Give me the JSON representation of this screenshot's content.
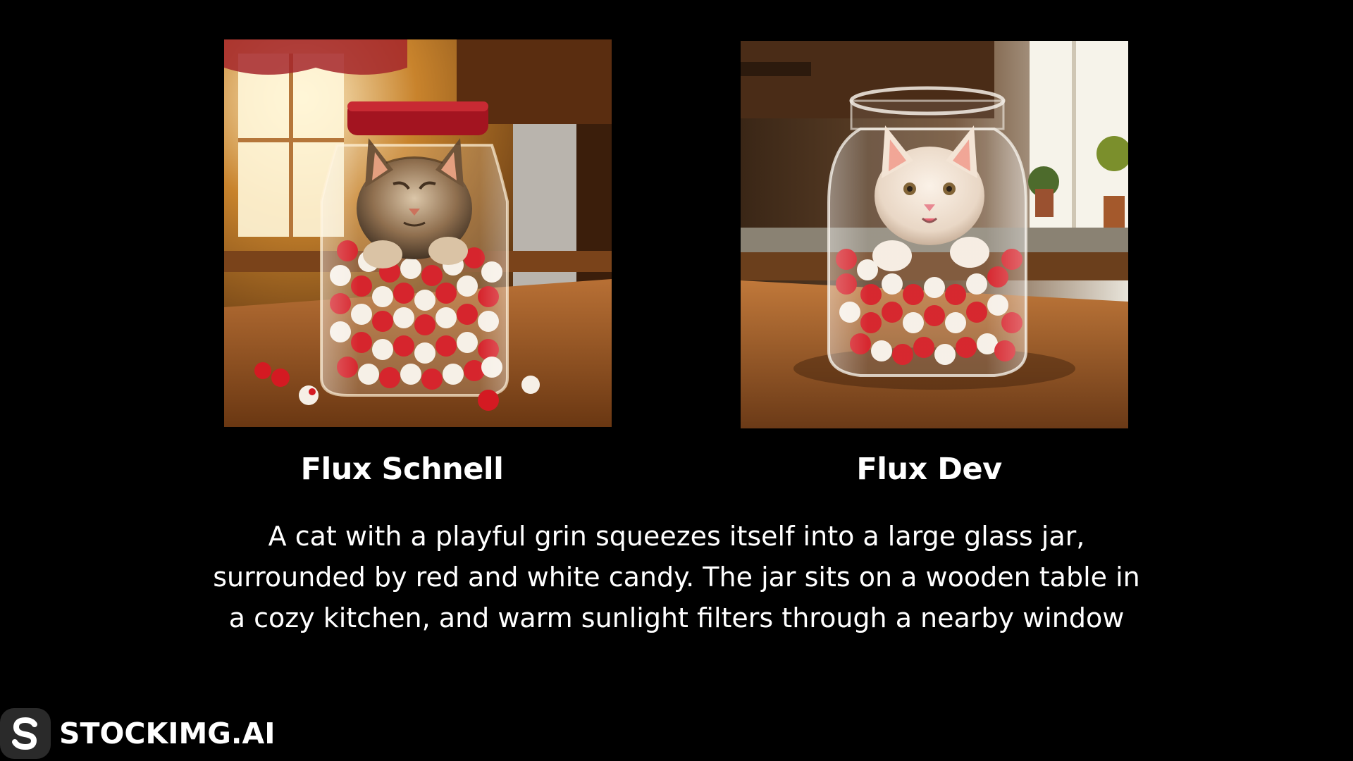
{
  "images": [
    {
      "model_label": "Flux Schnell",
      "subject": "tabby-cat-in-candy-jar-photo",
      "jar_lid_color": "#a31420"
    },
    {
      "model_label": "Flux Dev",
      "subject": "white-cat-in-candy-jar-photo",
      "jar_lid_color": "none"
    }
  ],
  "prompt_text": "A cat with a playful grin squeezes itself into a large glass jar, surrounded by red and white candy. The jar sits on a wooden table in a cozy kitchen, and warm sunlight filters through a nearby window",
  "brand": {
    "name": "STOCKIMG.AI",
    "logo_icon": "stockimg-s-logo-icon"
  },
  "colors": {
    "background": "#000000",
    "text": "#ffffff",
    "candy_red": "#d41a22",
    "candy_white": "#f6efe6"
  }
}
